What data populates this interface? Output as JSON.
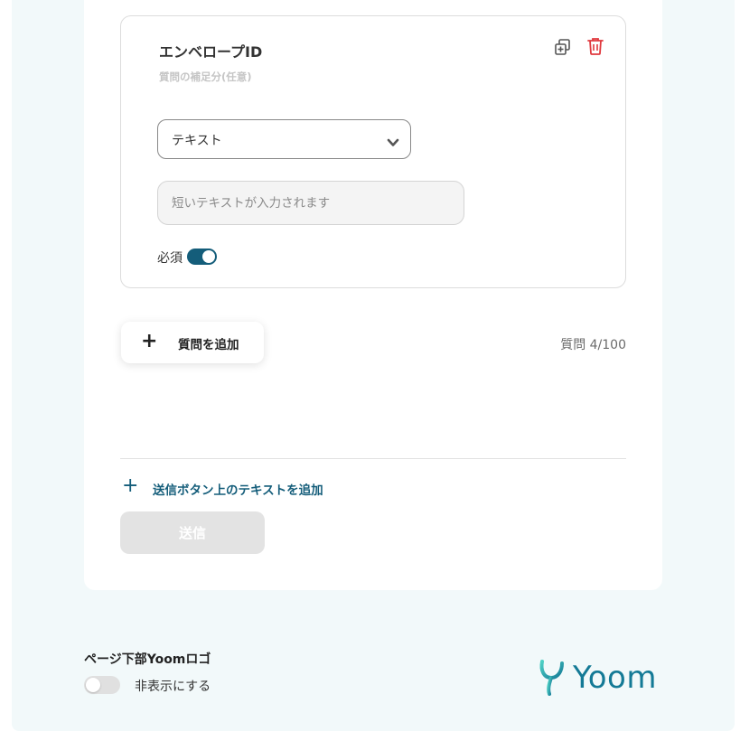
{
  "question": {
    "title": "エンベロープID",
    "subtitle": "質問の補足分(任意)",
    "type_select": {
      "value": "テキスト"
    },
    "answer_input": {
      "placeholder": "短いテキストが入力されます"
    },
    "required_label": "必須",
    "required": true
  },
  "add_question": {
    "label": "質問を追加",
    "count": "質問 4/100"
  },
  "add_text_above_submit": {
    "label": "送信ボタン上のテキストを追加"
  },
  "submit": {
    "label": "送信"
  },
  "footer": {
    "title": "ページ下部Yoomロゴ",
    "hide_label": "非表示にする",
    "hide_enabled": false,
    "logo_text": "Yoom"
  },
  "colors": {
    "accent": "#145d7a",
    "danger": "#e0393e",
    "logo": "#147a96",
    "background": "#f2f9fa"
  },
  "icons": [
    "copy-icon",
    "trash-icon",
    "drag-handle-icon",
    "chevron-down-icon",
    "plus-icon",
    "yoom-logo"
  ]
}
